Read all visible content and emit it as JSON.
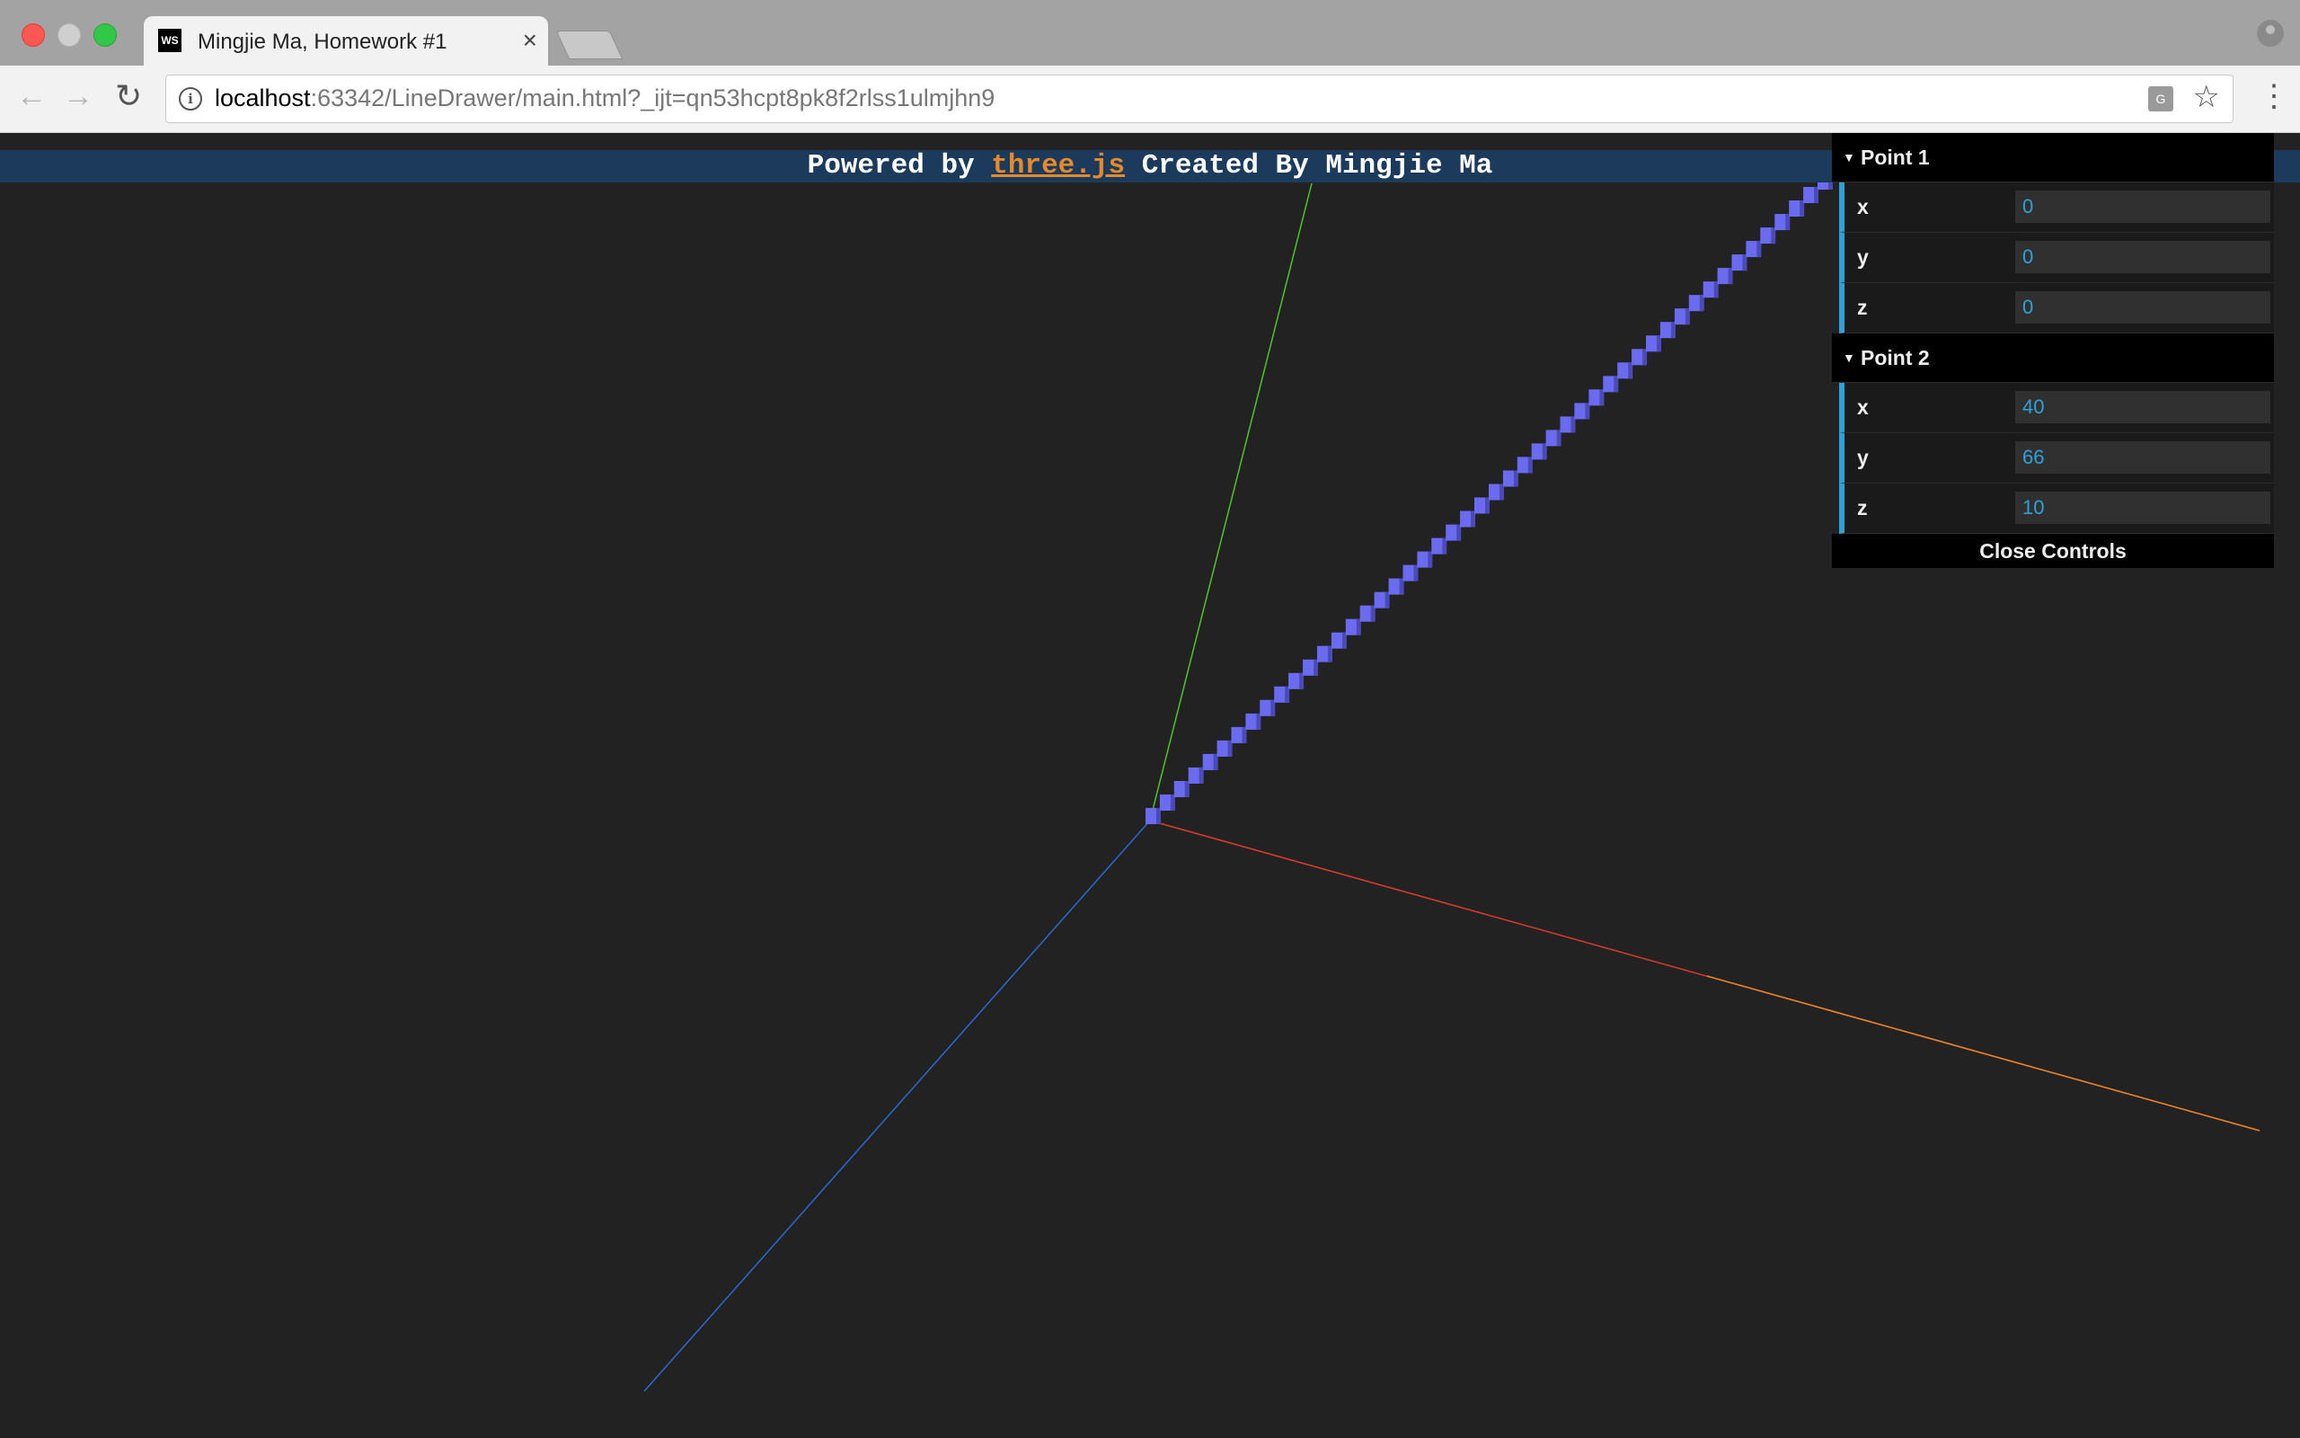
{
  "browser": {
    "tab_title": "Mingjie Ma, Homework #1",
    "tab_favicon": "WS",
    "tab_close": "×",
    "url_host": "localhost",
    "url_rest": ":63342/LineDrawer/main.html?_ijt=qn53hcpt8pk8f2rlss1ulmjhn9",
    "icons": {
      "back": "back-arrow-icon",
      "forward": "forward-arrow-icon",
      "reload": "reload-icon",
      "info": "info-icon",
      "translate": "translate-icon",
      "bookmark": "star-icon",
      "menu": "menu-icon",
      "profile": "profile-icon"
    }
  },
  "banner": {
    "prefix": "Powered by",
    "link": "three.js",
    "suffix": "Created By Mingjie Ma",
    "link_color": "#e58a2a"
  },
  "gui": {
    "folders": [
      {
        "title": "Point 1",
        "fields": [
          {
            "label": "x",
            "value": "0"
          },
          {
            "label": "y",
            "value": "0"
          },
          {
            "label": "z",
            "value": "0"
          }
        ]
      },
      {
        "title": "Point 2",
        "fields": [
          {
            "label": "x",
            "value": "40"
          },
          {
            "label": "y",
            "value": "66"
          },
          {
            "label": "z",
            "value": "10"
          }
        ]
      }
    ],
    "close_label": "Close Controls",
    "accent": "#2fa1d6"
  },
  "scene": {
    "background": "#222222",
    "axis_colors": {
      "x": "#e0392e",
      "y": "#4cc52a",
      "z": "#2a6ad0"
    },
    "line_color": "#6b6bf0",
    "voxel_steps": 48
  }
}
